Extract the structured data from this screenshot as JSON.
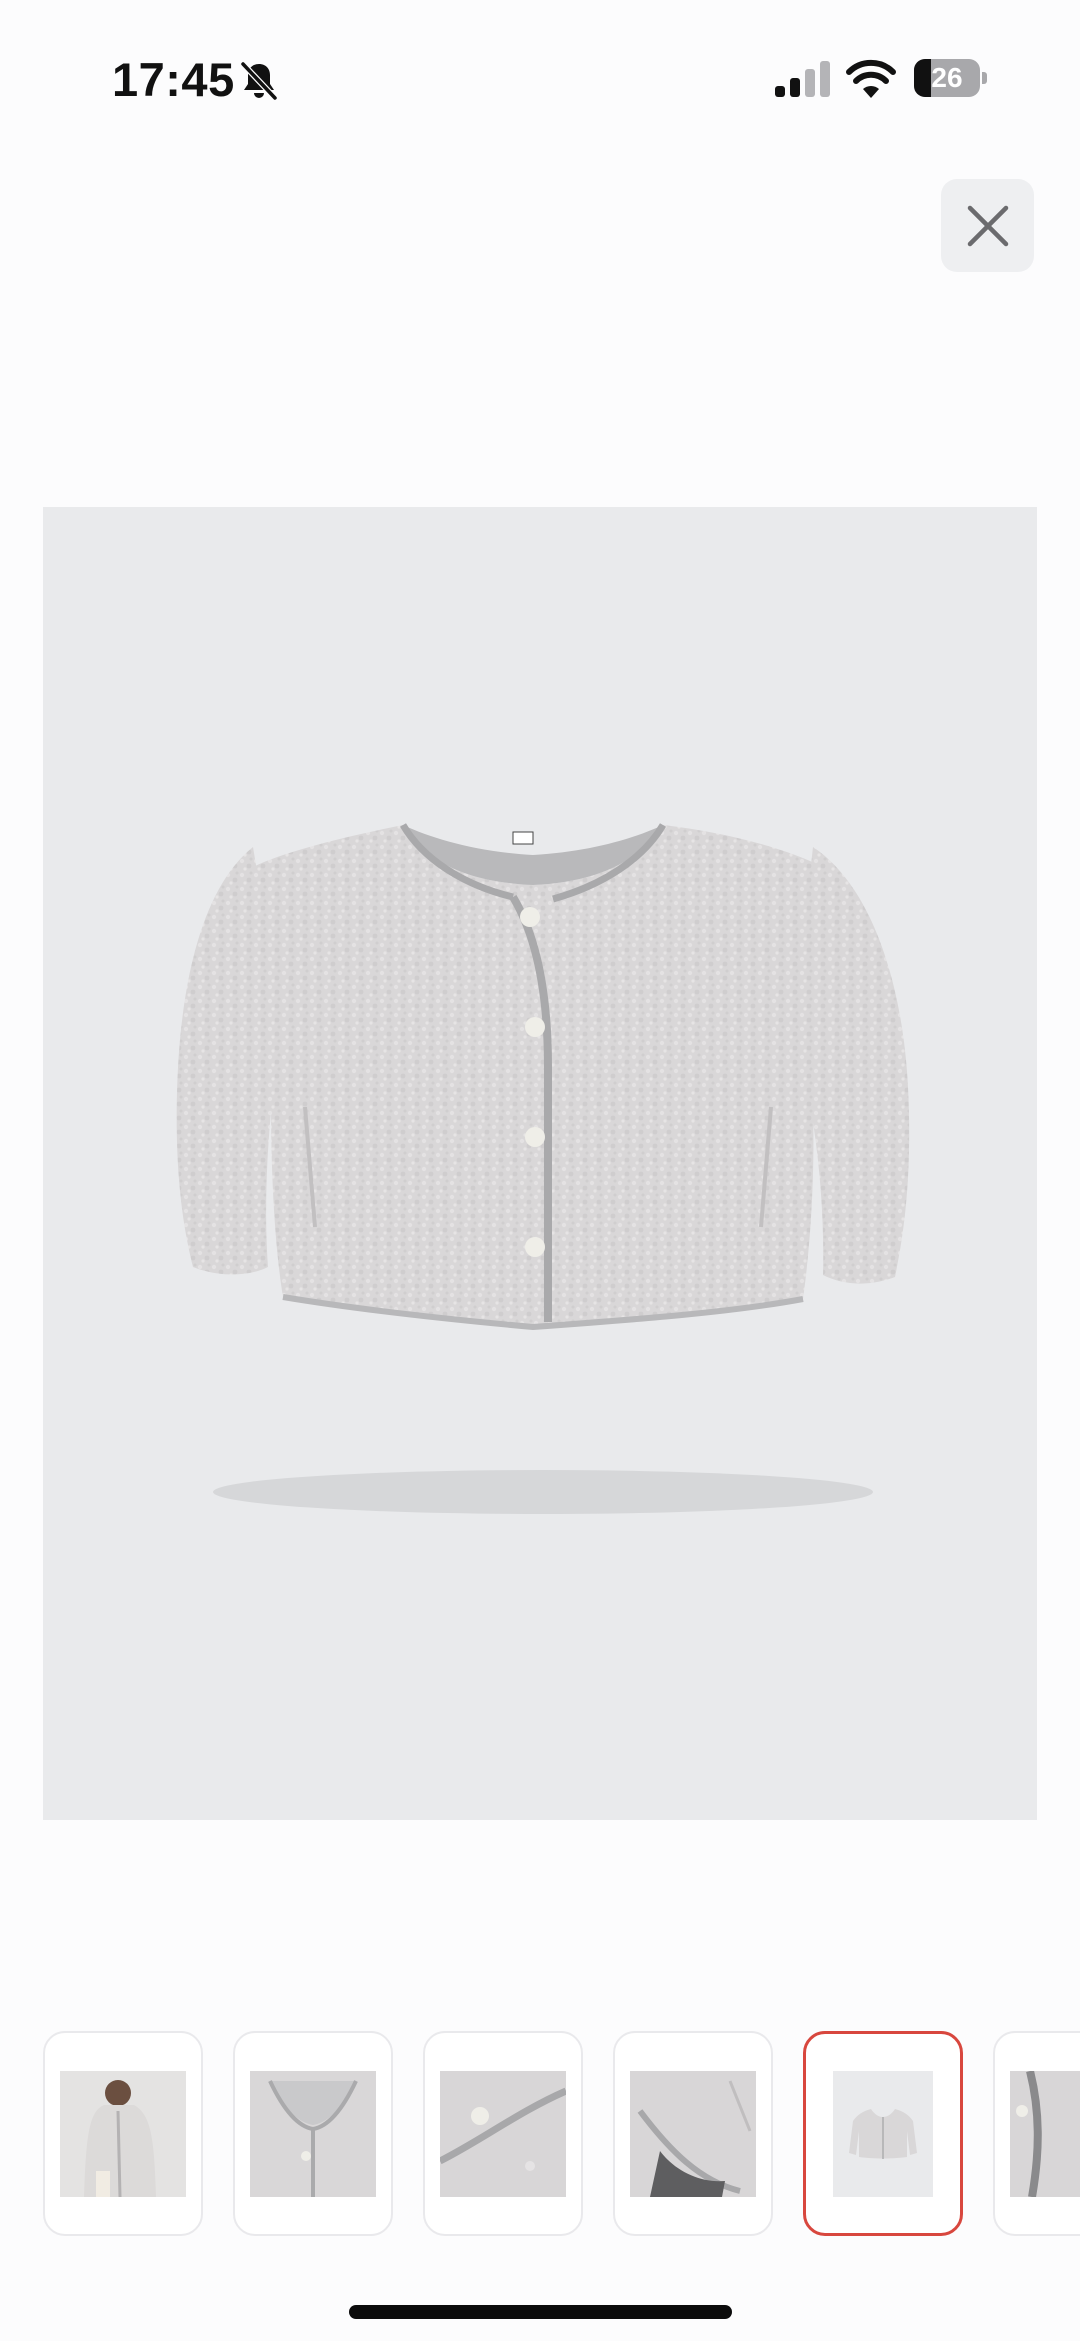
{
  "status_bar": {
    "time": "17:45",
    "battery_level": "26",
    "battery_fraction": 0.26,
    "icons": [
      "bell-slash-icon",
      "signal-icon",
      "wifi-icon",
      "battery-icon"
    ]
  },
  "header": {
    "close_icon": "close-icon"
  },
  "gallery": {
    "main_image": "fleece-cardigan-product-flat",
    "thumbnails": [
      {
        "image": "model-wearing-cardigan",
        "selected": false
      },
      {
        "image": "neckline-closeup",
        "selected": false
      },
      {
        "image": "button-detail-closeup",
        "selected": false
      },
      {
        "image": "sleeve-pocket-detail",
        "selected": false
      },
      {
        "image": "cardigan-flat-front",
        "selected": true
      },
      {
        "image": "placket-detail",
        "selected": false
      }
    ]
  },
  "colors": {
    "background": "#fcfcfd",
    "image_background": "#e9eaec",
    "selected_border": "#d8473e",
    "fabric": "#d9d7d8"
  }
}
